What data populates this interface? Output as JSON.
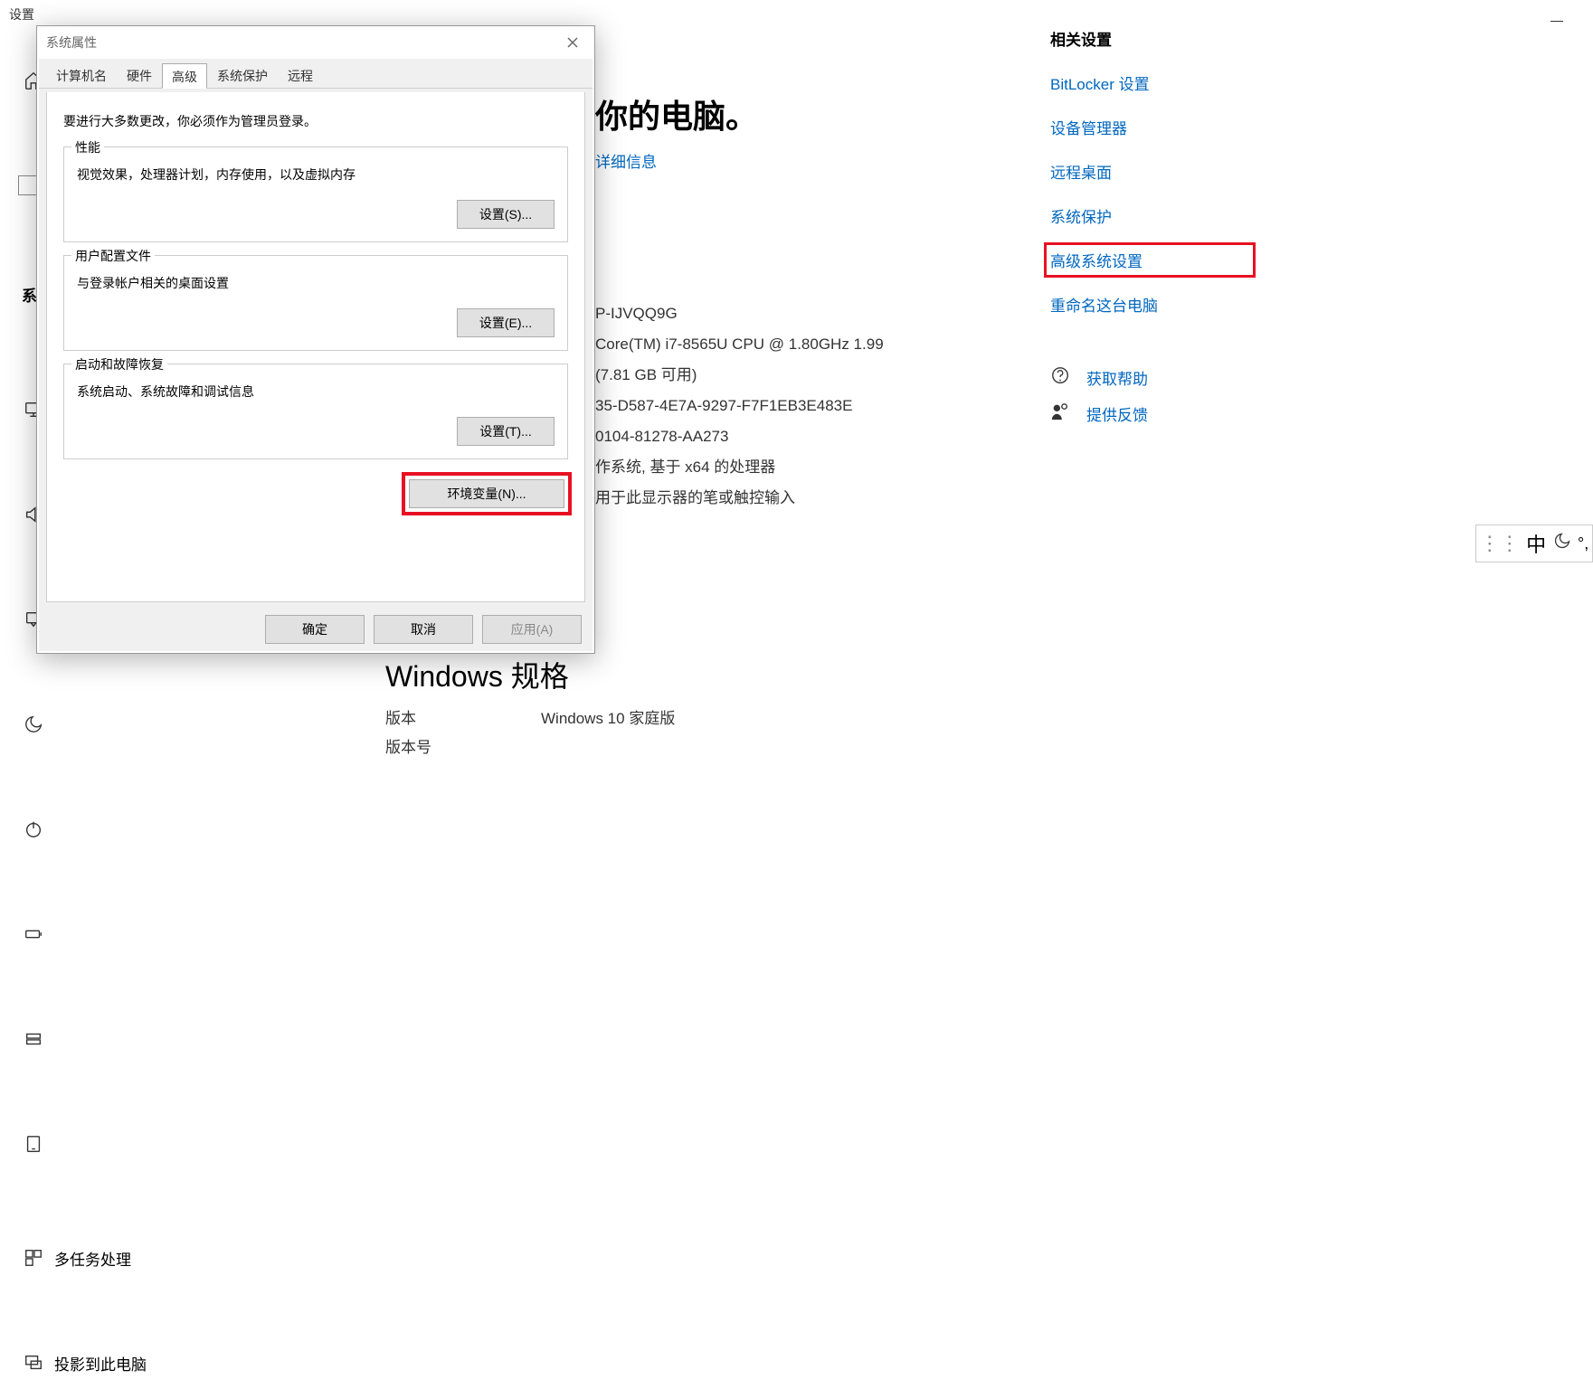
{
  "settings_header": "设置",
  "sidebar": {
    "items": [
      {
        "key": "home",
        "label": ""
      },
      {
        "key": "search",
        "label": ""
      },
      {
        "key": "system",
        "label": "系约"
      },
      {
        "key": "display",
        "label": ""
      },
      {
        "key": "sound",
        "label": ""
      },
      {
        "key": "notify",
        "label": ""
      },
      {
        "key": "focus",
        "label": ""
      },
      {
        "key": "power",
        "label": ""
      },
      {
        "key": "battery",
        "label": ""
      },
      {
        "key": "storage",
        "label": ""
      },
      {
        "key": "tablet",
        "label": ""
      },
      {
        "key": "multitask",
        "label": "多任务处理"
      },
      {
        "key": "project",
        "label": "投影到此电脑"
      }
    ]
  },
  "main": {
    "title_tail": "你的电脑。",
    "detail_link": "详细信息",
    "info": [
      "P-IJVQQ9G",
      "Core(TM) i7-8565U CPU @ 1.80GHz   1.99",
      "(7.81 GB 可用)",
      "35-D587-4E7A-9297-F7F1EB3E483E",
      "0104-81278-AA273",
      "作系统, 基于 x64 的处理器",
      "用于此显示器的笔或触控输入"
    ],
    "windows_spec": "Windows 规格",
    "spec_label": "版本",
    "spec_value": "Windows 10 家庭版",
    "spec_label2": "版本号"
  },
  "right": {
    "heading": "相关设置",
    "links": [
      "BitLocker 设置",
      "设备管理器",
      "远程桌面",
      "系统保护",
      "高级系统设置",
      "重命名这台电脑"
    ],
    "help": "获取帮助",
    "feedback": "提供反馈"
  },
  "ime": {
    "lang": "中"
  },
  "dialog": {
    "title": "系统属性",
    "tabs": [
      "计算机名",
      "硬件",
      "高级",
      "系统保护",
      "远程"
    ],
    "admin_note": "要进行大多数更改，你必须作为管理员登录。",
    "perf": {
      "legend": "性能",
      "desc": "视觉效果，处理器计划，内存使用，以及虚拟内存",
      "btn": "设置(S)..."
    },
    "profile": {
      "legend": "用户配置文件",
      "desc": "与登录帐户相关的桌面设置",
      "btn": "设置(E)..."
    },
    "startup": {
      "legend": "启动和故障恢复",
      "desc": "系统启动、系统故障和调试信息",
      "btn": "设置(T)..."
    },
    "env_btn": "环境变量(N)...",
    "ok": "确定",
    "cancel": "取消",
    "apply": "应用(A)"
  }
}
